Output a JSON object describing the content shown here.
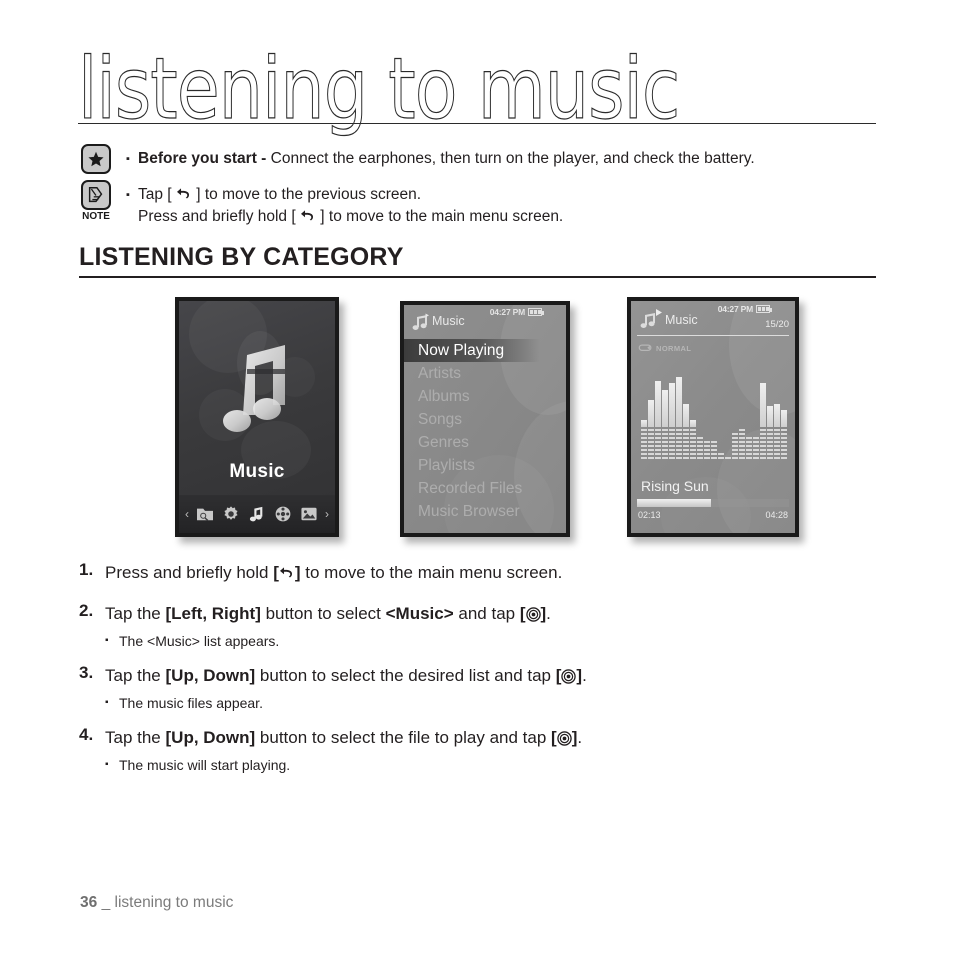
{
  "page": {
    "title": "listening to music",
    "section_heading": "LISTENING BY CATEGORY",
    "footer_page": "36",
    "footer_sep": "_",
    "footer_text": "listening to music"
  },
  "notes": {
    "icon_star": "star-badge",
    "icon_note": "note-hand-badge",
    "note_label": "NOTE",
    "bullet": "▪",
    "line1_bold": "Before you start -",
    "line1_rest": " Connect the earphones, then turn on the player, and check the battery.",
    "line2_pre": "Tap [ ",
    "line2_post": " ] to move to the previous screen.",
    "line3_pre": "Press and briefly hold [ ",
    "line3_post": " ] to move to the main menu screen."
  },
  "screens": {
    "menu": {
      "label": "Music",
      "left_arrow": "‹",
      "right_arrow": "›",
      "icons": [
        "file-browser-icon",
        "settings-icon",
        "music-icon",
        "video-icon",
        "pictures-icon"
      ]
    },
    "list": {
      "header_title": "Music",
      "clock": "04:27 PM",
      "battery": "battery-full-icon",
      "items": [
        "Now Playing",
        "Artists",
        "Albums",
        "Songs",
        "Genres",
        "Playlists",
        "Recorded Files",
        "Music Browser"
      ],
      "selected_index": 0
    },
    "player": {
      "header_title": "Music",
      "clock": "04:27 PM",
      "battery": "battery-full-icon",
      "track_count": "15/20",
      "repeat_mode": "NORMAL",
      "repeat_icon": "repeat-icon",
      "song_title": "Rising Sun",
      "elapsed": "02:13",
      "total": "04:28",
      "progress_percent": 49,
      "equalizer_levels": [
        42,
        62,
        82,
        72,
        80,
        86,
        58,
        42,
        24,
        20,
        20,
        8,
        6,
        30,
        34,
        26,
        26,
        80,
        56,
        58,
        52
      ]
    }
  },
  "steps": [
    {
      "num": "1.",
      "parts": [
        {
          "t": "Press and briefly hold ",
          "b": false
        },
        {
          "t": "[",
          "b": true
        },
        {
          "t": "back-icon",
          "b": false,
          "icon": "back"
        },
        {
          "t": "]",
          "b": true
        },
        {
          "t": " to move to the main menu screen.",
          "b": false
        }
      ],
      "sub": null
    },
    {
      "num": "2.",
      "parts": [
        {
          "t": "Tap the ",
          "b": false
        },
        {
          "t": "[Left, Right]",
          "b": true
        },
        {
          "t": " button to select ",
          "b": false
        },
        {
          "t": "<Music>",
          "b": true
        },
        {
          "t": " and tap ",
          "b": false
        },
        {
          "t": "[",
          "b": true
        },
        {
          "t": "wheel-icon",
          "b": false,
          "icon": "wheel"
        },
        {
          "t": "]",
          "b": true
        },
        {
          "t": ".",
          "b": false
        }
      ],
      "sub": "The <Music> list appears."
    },
    {
      "num": "3.",
      "parts": [
        {
          "t": "Tap the ",
          "b": false
        },
        {
          "t": "[Up, Down]",
          "b": true
        },
        {
          "t": " button to select the desired list and tap ",
          "b": false
        },
        {
          "t": "[",
          "b": true
        },
        {
          "t": "wheel-icon",
          "b": false,
          "icon": "wheel"
        },
        {
          "t": "]",
          "b": true
        },
        {
          "t": ".",
          "b": false
        }
      ],
      "sub": "The music files appear."
    },
    {
      "num": "4.",
      "parts": [
        {
          "t": "Tap the ",
          "b": false
        },
        {
          "t": "[Up, Down]",
          "b": true
        },
        {
          "t": " button to select the file to play and tap ",
          "b": false
        },
        {
          "t": "[",
          "b": true
        },
        {
          "t": "wheel-icon",
          "b": false,
          "icon": "wheel"
        },
        {
          "t": "]",
          "b": true
        },
        {
          "t": ".",
          "b": false
        }
      ],
      "sub": "The music will start playing."
    }
  ],
  "colors": {
    "ink": "#231f20",
    "footer": "#7b7b7b",
    "screen_dark": "#3a3a3c",
    "screen_gray": "#8d8d8d",
    "highlight": "#3c3c3c"
  }
}
